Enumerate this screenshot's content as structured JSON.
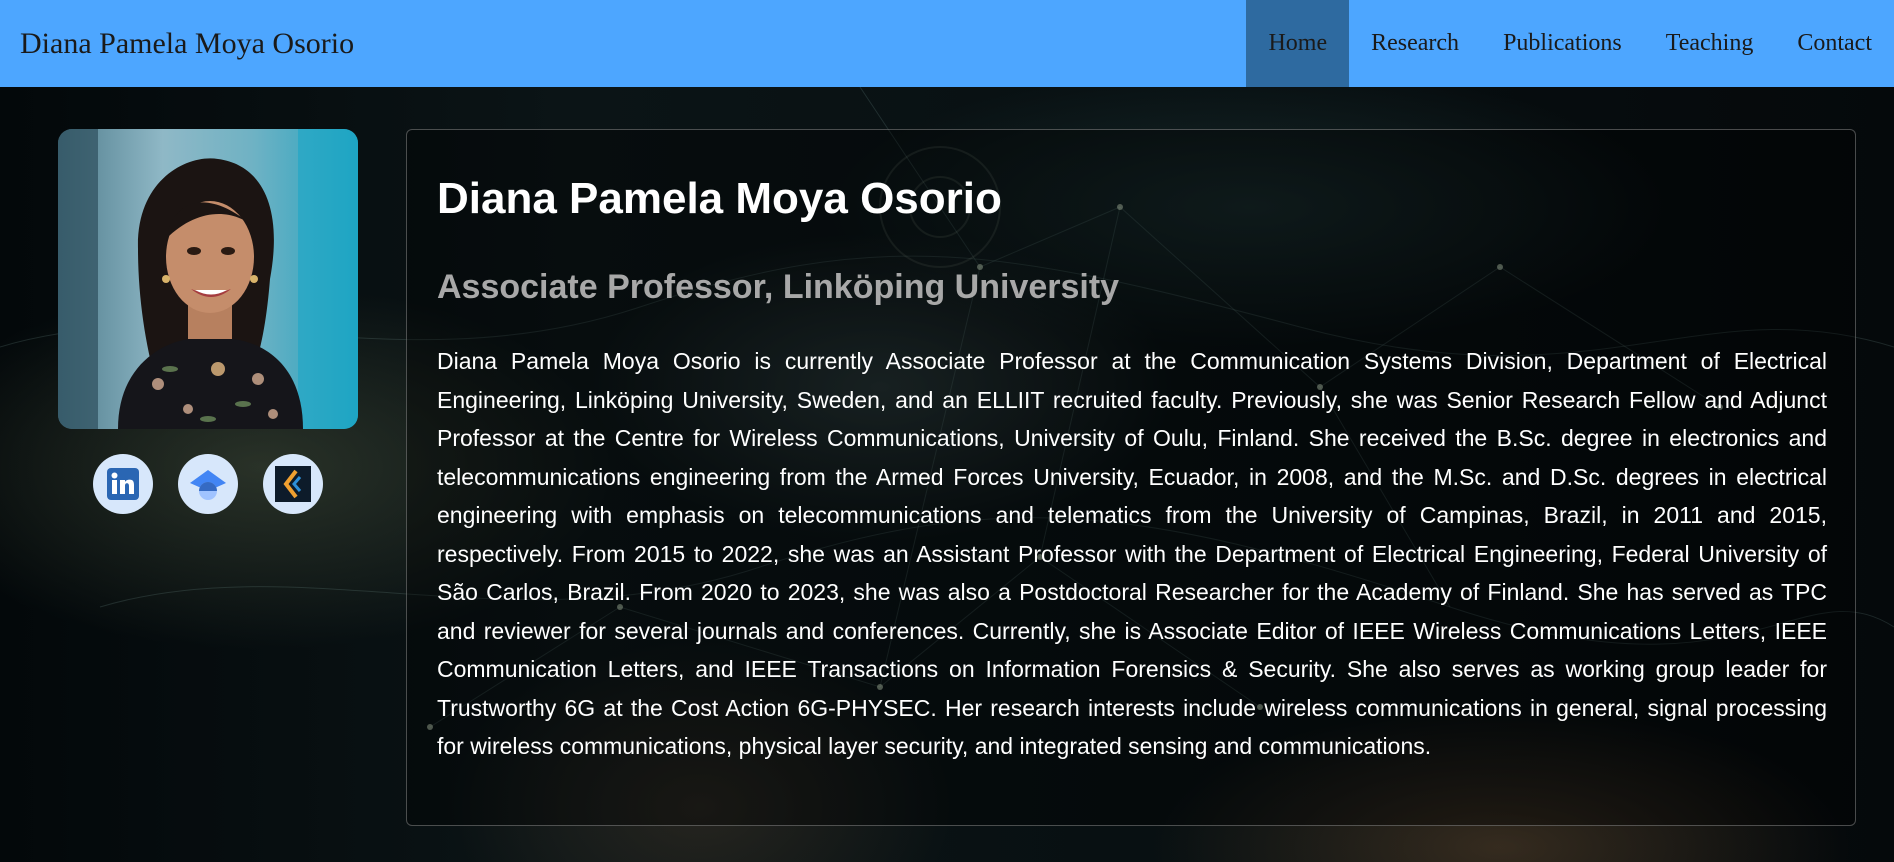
{
  "header": {
    "site_title": "Diana Pamela Moya Osorio",
    "nav": [
      {
        "label": "Home",
        "active": true
      },
      {
        "label": "Research",
        "active": false
      },
      {
        "label": "Publications",
        "active": false
      },
      {
        "label": "Teaching",
        "active": false
      },
      {
        "label": "Contact",
        "active": false
      }
    ],
    "bar_color": "#4da6ff",
    "active_color": "#2e6aa0"
  },
  "sidebar": {
    "photo_icon": "profile-photo",
    "social_links": [
      {
        "icon": "linkedin-icon"
      },
      {
        "icon": "google-scholar-icon"
      },
      {
        "icon": "orcid-diva-icon"
      }
    ]
  },
  "profile": {
    "name": "Diana Pamela Moya Osorio",
    "title": "Associate Professor, Linköping University",
    "bio": "Diana Pamela Moya Osorio is currently Associate Professor at the Communication Systems Division, Department of Electrical Engineering, Linköping University, Sweden, and an ELLIIT recruited faculty. Previously, she was Senior Research Fellow and Adjunct Professor at the Centre for Wireless Communications, University of Oulu, Finland. She received the B.Sc. degree in electronics and telecommunications engineering from the Armed Forces University, Ecuador, in 2008, and the M.Sc. and D.Sc. degrees in electrical engineering with emphasis on telecommunications and telematics from the University of Campinas, Brazil, in 2011 and 2015, respectively. From 2015 to 2022, she was an Assistant Professor with the Department of Electrical Engineering, Federal University of São Carlos, Brazil. From 2020 to 2023, she was also a Postdoctoral Researcher for the Academy of Finland. She has served as TPC and reviewer for several journals and conferences. Currently, she is Associate Editor of IEEE Wireless Communications Letters, IEEE Communication Letters, and IEEE Transactions on Information Forensics & Security. She also serves as working group leader for Trustworthy 6G at the Cost Action 6G-PHYSEC. Her research interests include wireless communications in general, signal processing for wireless communications, physical layer security, and integrated sensing and communications."
  }
}
